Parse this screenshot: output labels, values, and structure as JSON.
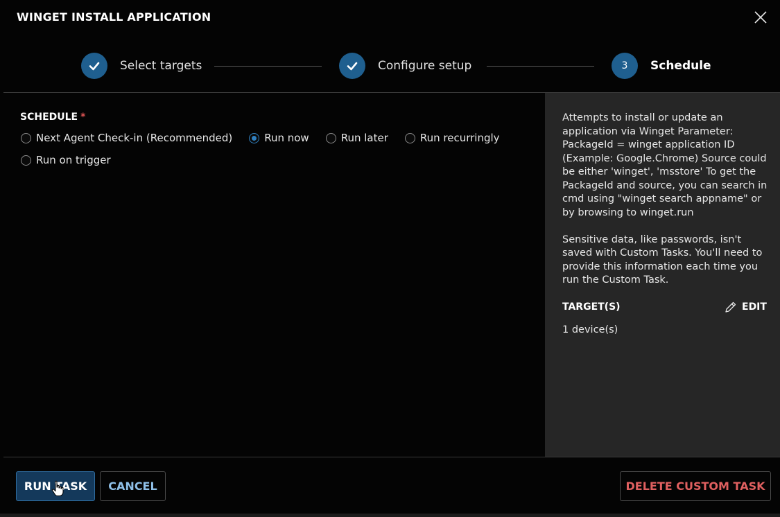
{
  "dialog": {
    "title": "WINGET INSTALL APPLICATION",
    "close_icon": "close-icon"
  },
  "stepper": {
    "steps": [
      {
        "label": "Select targets",
        "state": "complete",
        "icon": "check-icon"
      },
      {
        "label": "Configure setup",
        "state": "complete",
        "icon": "check-icon"
      },
      {
        "label": "Schedule",
        "state": "active",
        "number": "3"
      }
    ]
  },
  "schedule": {
    "label": "SCHEDULE",
    "required_mark": "*",
    "options": [
      {
        "label": "Next Agent Check-in (Recommended)",
        "checked": false
      },
      {
        "label": "Run now",
        "checked": true
      },
      {
        "label": "Run later",
        "checked": false
      },
      {
        "label": "Run recurringly",
        "checked": false
      },
      {
        "label": "Run on trigger",
        "checked": false
      }
    ]
  },
  "side_panel": {
    "description_1": "Attempts to install or update an application via Winget Parameter: PackageId = winget application ID (Example: Google.Chrome) Source could be either 'winget', 'msstore' To get the PackageId and source, you can search in cmd using \"winget search appname\" or by browsing to winget.run",
    "description_2": "Sensitive data, like passwords, isn't saved with Custom Tasks. You'll need to provide this information each time you run the Custom Task.",
    "targets_label": "TARGET(S)",
    "edit_label": "EDIT",
    "edit_icon": "pencil-icon",
    "device_count": "1 device(s)"
  },
  "footer": {
    "run_label": "RUN TASK",
    "cancel_label": "CANCEL",
    "delete_label": "DELETE CUSTOM TASK"
  },
  "colors": {
    "accent": "#1f5f8f",
    "radio_checked": "#2f80c0",
    "danger": "#e06060",
    "link": "#8fc0e8",
    "panel_bg": "#262626"
  }
}
